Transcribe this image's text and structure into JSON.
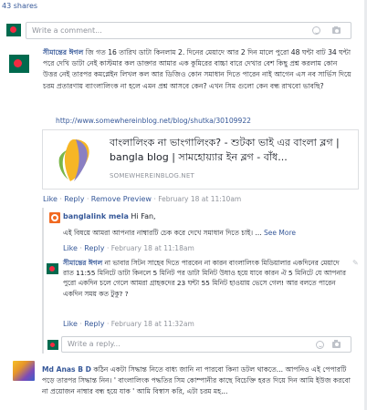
{
  "shares_label": "43 shares",
  "top_comment_box": {
    "placeholder": "Write a comment..."
  },
  "post1": {
    "author": "সীমান্তের ঈগল",
    "text": "জি গত 16 তারিখ ডাটা কিনলাম 2. দিনের মেয়াদে আর 2 দিন মালে পুরো 48 ঘন্টা বাট 34 ঘন্টা পরে দেখি ডাটা নেই কাস্টমার কল ডাক্তার আমার এক কুমিরের বাচ্চা বারে দেখার বেশ কিছু প্রশ্ন করলাম কোন উত্তর নেই তারপর কমপ্লেইন লিখল কল আর ডিজিও কোন সমাধান দিতে পারেন নাই আগেন এস নব সার্ভিস দিয়ে চরম প্রতারণায় ব্যাংলালিংক না হলে এমন প্রশ্ন আসবে কেন? এখন সিম গুলো কেন বন্ধ রাখবো ভাবছি?",
    "link_url": "http://www.somewhereinblog.net/blog/shutka/30109922",
    "preview": {
      "title": "বাংলালিংক না ভাংগালিংক? - শুটকা ভাই এর বাংলা ব্লগ | bangla blog | সামহোয়্যার ইন ব্লগ - বাঁধ...",
      "domain": "SOMEWHEREINBLOG.NET"
    },
    "actions": {
      "like": "Like",
      "reply": "Reply",
      "remove_preview": "Remove Preview",
      "time": "February 18 at 11:10am"
    }
  },
  "reply1": {
    "author": "banglalink mela",
    "greeting": "Hi Fan,",
    "text": "এই বিষয়ে আমরা আপনার নাম্বারটি চেক করে দেখে সমাধান দিতে চাই। ...",
    "see_more": "See More",
    "actions": {
      "like": "Like",
      "reply": "Reply",
      "time": "February 18 at 11:18am"
    }
  },
  "reply2": {
    "author": "সীমান্তের ঈগল",
    "text": "না ভাবার সিটন সাহেব দিতে পারবেন না কারন বাংলালিংক মিডিয়ালার একদিনের মেয়াদে রাত 11:55 মিনিটে ডাটা কিনলে 5 মিনিট পর ডাটা মিনিট উধাও হয়ে যাবে কারন ঐ 5 মিনিটে যে আপনার পুরো একদিন চলে গেলে আমরা গ্রাহকদের 23 ঘন্টা 55 মিনিট হাওয়ায় ভেসে গেল! আর বলতে পারেন একদিন সময় কত টুকু? ?",
    "actions": {
      "like": "Like",
      "reply": "Reply",
      "time": "February 18 at 11:32am"
    }
  },
  "reply_box": {
    "placeholder": "Write a reply..."
  },
  "post2": {
    "author": "Md Anas B D",
    "text": "কঠিন একটা সিদ্ধান্ত নিতে বাধ্য জানি না পারবো কিনা ডটল থাকতে... আপনিও এই পেপারটি পড়ে তারপর সিদ্ধান্ত নিন। ' বাংলালিংক পদ্ধতির সিম কোম্পানীর কাছে বিচেক্তি হরত দিয়ে দিন আমি ইউজ করবো না প্রয়োজন নাম্বার বন্ধ হয়ে যাক ' আমি বিস্বাস করি, এটা চরম মহ..."
  },
  "colors": {
    "link": "#365899",
    "meta": "#90949c",
    "flag_green": "#006a4e",
    "flag_red": "#f42a41",
    "brand_orange": "#f16a22"
  }
}
